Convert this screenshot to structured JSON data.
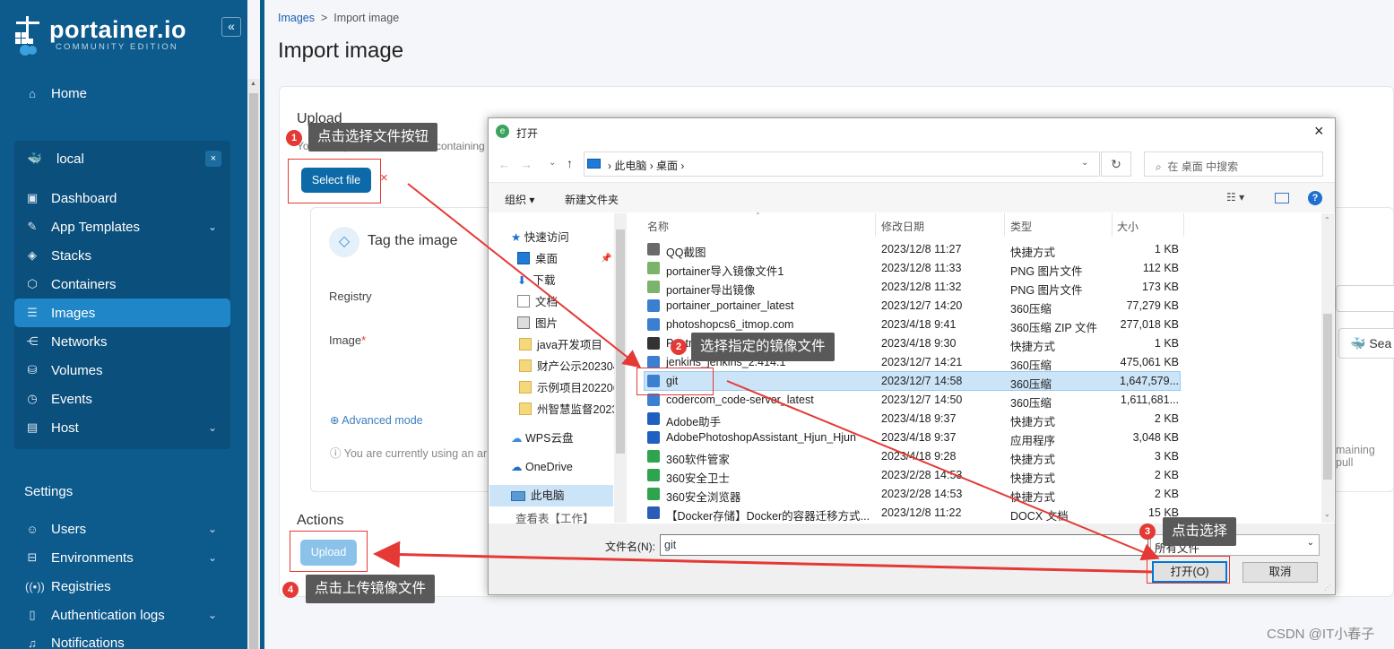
{
  "sidebar": {
    "logo": "portainer.io",
    "edition": "COMMUNITY EDITION",
    "collapse": "«",
    "home": "Home",
    "env_name": "local",
    "env_close": "×",
    "items": [
      {
        "label": "Dashboard",
        "icon": "dashboard-icon"
      },
      {
        "label": "App Templates",
        "icon": "templates-icon"
      },
      {
        "label": "Stacks",
        "icon": "stacks-icon"
      },
      {
        "label": "Containers",
        "icon": "containers-icon"
      },
      {
        "label": "Images",
        "icon": "images-icon"
      },
      {
        "label": "Networks",
        "icon": "networks-icon"
      },
      {
        "label": "Volumes",
        "icon": "volumes-icon"
      },
      {
        "label": "Events",
        "icon": "events-icon"
      },
      {
        "label": "Host",
        "icon": "host-icon"
      }
    ],
    "settings_title": "Settings",
    "settings": [
      {
        "label": "Users"
      },
      {
        "label": "Environments"
      },
      {
        "label": "Registries"
      },
      {
        "label": "Authentication logs"
      },
      {
        "label": "Notifications"
      }
    ]
  },
  "breadcrumb": {
    "parent": "Images",
    "sep": ">",
    "current": "Import image"
  },
  "page_title": "Import image",
  "upload": {
    "title": "Upload",
    "desc_left": "You can upload a tar archive containing",
    "select_file": "Select file",
    "remove": "×"
  },
  "tag": {
    "title": "Tag the image",
    "registry": "Registry",
    "image": "Image",
    "required": "*",
    "advanced": "Advanced mode",
    "notice_left": "You are currently using an ar",
    "notice_right": "maining pull",
    "search_label": "Sea"
  },
  "actions": {
    "title": "Actions",
    "upload": "Upload"
  },
  "callouts": [
    {
      "n": "1",
      "text": "点击选择文件按钮"
    },
    {
      "n": "2",
      "text": "选择指定的镜像文件"
    },
    {
      "n": "3",
      "text": "点击选择"
    },
    {
      "n": "4",
      "text": "点击上传镜像文件"
    }
  ],
  "dialog": {
    "title": "打开",
    "close": "×",
    "path": [
      "此电脑",
      "桌面"
    ],
    "search": "在 桌面 中搜索",
    "organize": "组织 ▾",
    "new_folder": "新建文件夹",
    "help": "?",
    "columns": [
      "名称",
      "修改日期",
      "类型",
      "大小"
    ],
    "nav": [
      "快速访问",
      "桌面",
      "下载",
      "文档",
      "图片",
      "java开发项目",
      "财产公示202304",
      "示例项目202206",
      "州智慧监督2023",
      "WPS云盘",
      "OneDrive",
      "此电脑",
      "查看表【工作】"
    ],
    "files": [
      {
        "name": "QQ截图",
        "date": "2023/12/8 11:27",
        "type": "快捷方式",
        "size": "1 KB",
        "color": "#6a6a6a"
      },
      {
        "name": "portainer导入镜像文件1",
        "date": "2023/12/8 11:33",
        "type": "PNG 图片文件",
        "size": "112 KB",
        "color": "#7bb36b"
      },
      {
        "name": "portainer导出镜像",
        "date": "2023/12/8 11:32",
        "type": "PNG 图片文件",
        "size": "173 KB",
        "color": "#7bb36b"
      },
      {
        "name": "portainer_portainer_latest",
        "date": "2023/12/7 14:20",
        "type": "360压缩",
        "size": "77,279 KB",
        "color": "#3a7fd0"
      },
      {
        "name": "photoshopcs6_itmop.com",
        "date": "2023/4/18 9:41",
        "type": "360压缩 ZIP 文件",
        "size": "277,018 KB",
        "color": "#3a7fd0"
      },
      {
        "name": "Postman",
        "date": "2023/4/18 9:30",
        "type": "快捷方式",
        "size": "1 KB",
        "color": "#333"
      },
      {
        "name": "jenkins_jenkins_2.414.1",
        "date": "2023/12/7 14:21",
        "type": "360压缩",
        "size": "475,061 KB",
        "color": "#3a7fd0"
      },
      {
        "name": "git",
        "date": "2023/12/7 14:58",
        "type": "360压缩",
        "size": "1,647,579...",
        "color": "#3a7fd0"
      },
      {
        "name": "codercom_code-server_latest",
        "date": "2023/12/7 14:50",
        "type": "360压缩",
        "size": "1,611,681...",
        "color": "#3a7fd0"
      },
      {
        "name": "Adobe助手",
        "date": "2023/4/18 9:37",
        "type": "快捷方式",
        "size": "2 KB",
        "color": "#1f5fbf"
      },
      {
        "name": "AdobePhotoshopAssistant_Hjun_Hjun",
        "date": "2023/4/18 9:37",
        "type": "应用程序",
        "size": "3,048 KB",
        "color": "#1f5fbf"
      },
      {
        "name": "360软件管家",
        "date": "2023/4/18 9:28",
        "type": "快捷方式",
        "size": "3 KB",
        "color": "#2ea44f"
      },
      {
        "name": "360安全卫士",
        "date": "2023/2/28 14:53",
        "type": "快捷方式",
        "size": "2 KB",
        "color": "#2ea44f"
      },
      {
        "name": "360安全浏览器",
        "date": "2023/2/28 14:53",
        "type": "快捷方式",
        "size": "2 KB",
        "color": "#2ea44f"
      },
      {
        "name": "【Docker存储】Docker的容器迁移方式...",
        "date": "2023/12/8 11:22",
        "type": "DOCX 文档",
        "size": "15 KB",
        "color": "#2b5cb8"
      }
    ],
    "filename_label": "文件名(N):",
    "filename": "git",
    "filetype": "所有文件",
    "open": "打开(O)",
    "cancel": "取消"
  },
  "watermark": "CSDN @IT小春子",
  "colors": {
    "sidebar": "#0d5a8c",
    "accent": "#0c6aa8",
    "annotation": "#e53935"
  }
}
